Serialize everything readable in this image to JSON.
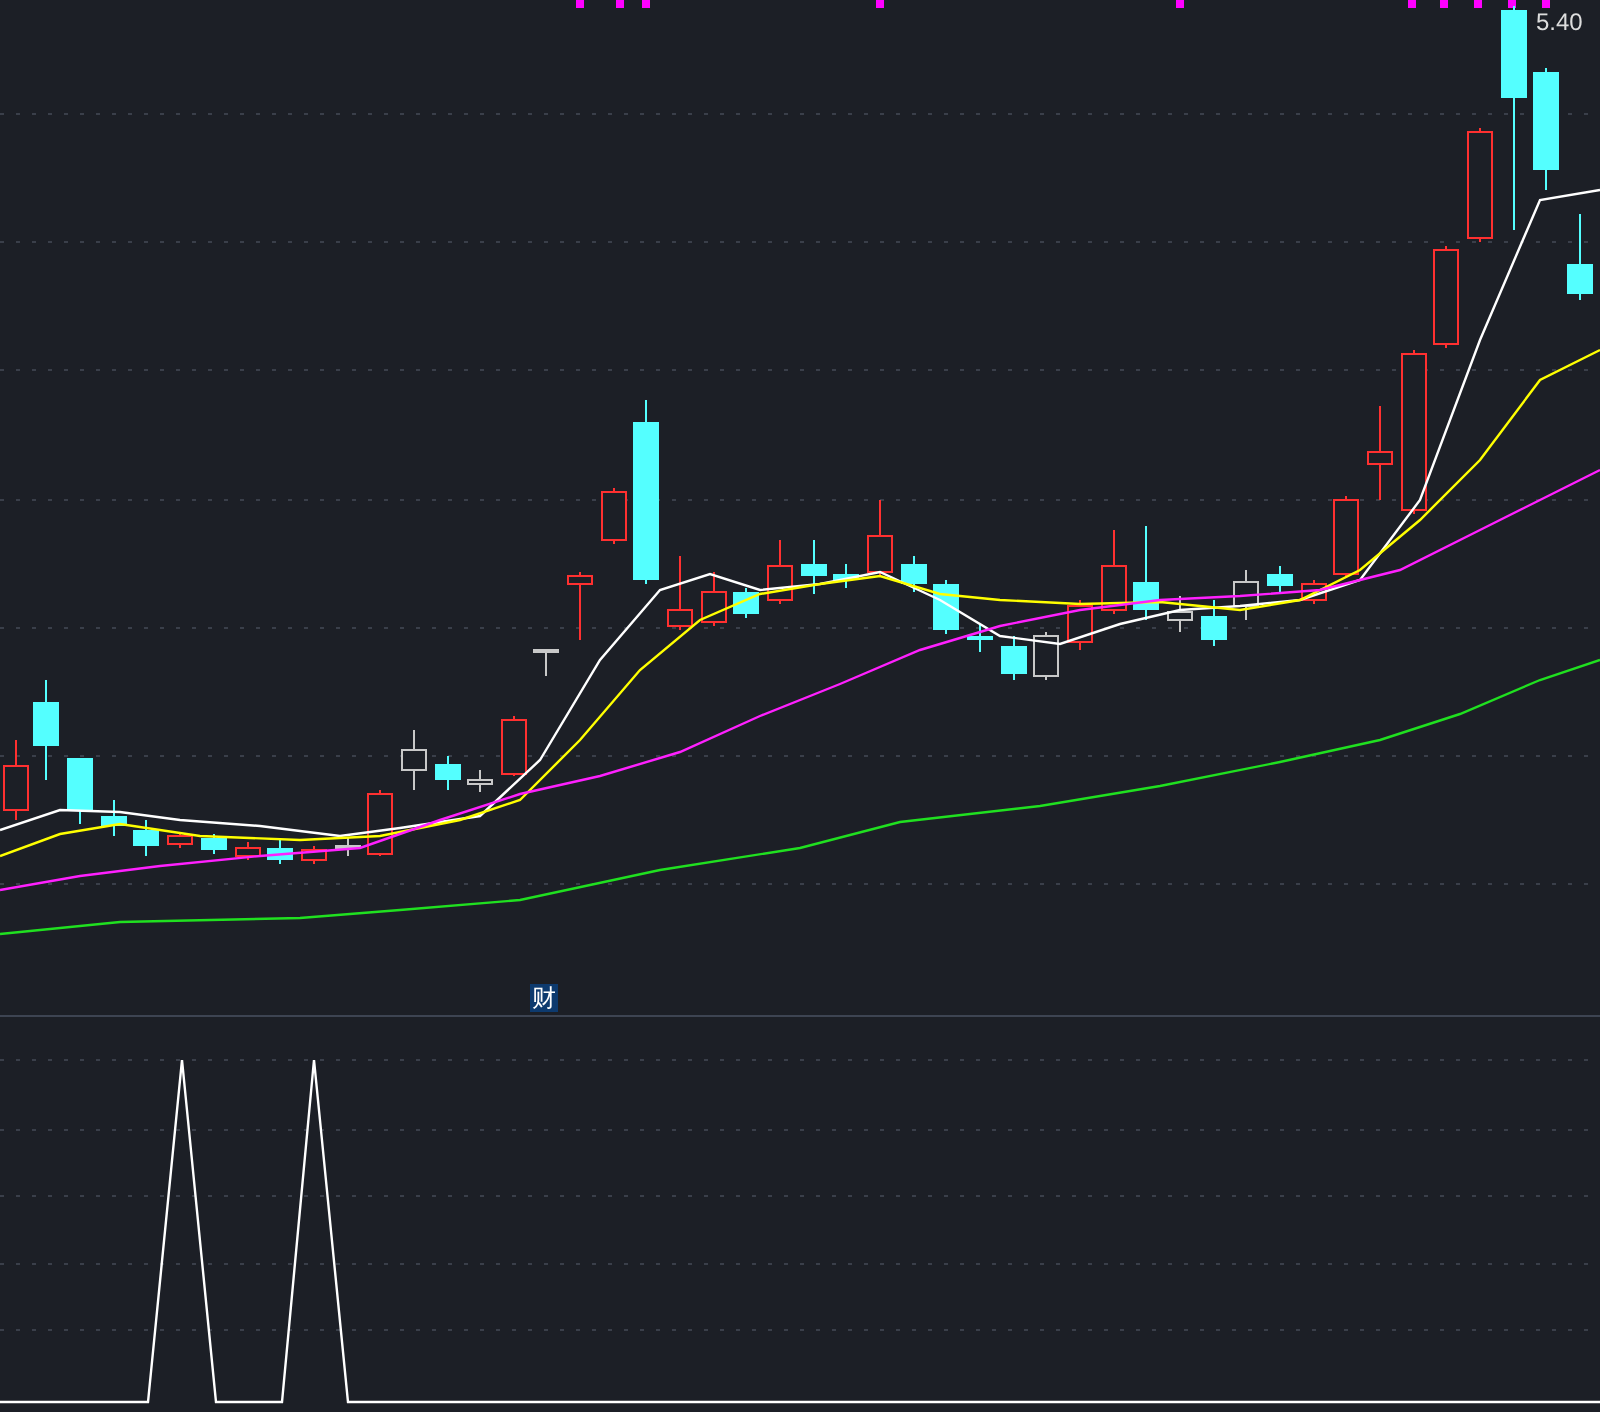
{
  "price_label": "5.40",
  "marker": {
    "label": "财"
  }
}
